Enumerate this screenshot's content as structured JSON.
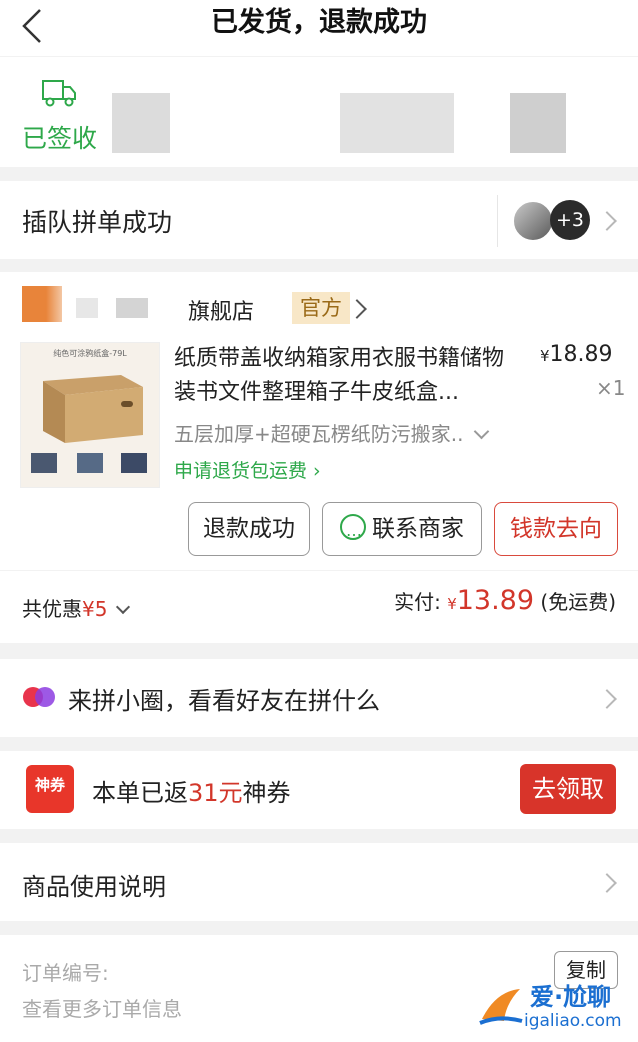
{
  "header": {
    "title": "已发货，退款成功",
    "back_icon": "chevron-left-icon"
  },
  "status": {
    "label": "已签收",
    "icon": "truck-icon"
  },
  "group": {
    "text": "插队拼单成功",
    "extra_count": "+3"
  },
  "order": {
    "shop_name": "旗舰店",
    "official_badge": "官方",
    "product_title": "纸质带盖收纳箱家用衣服书籍储物装书文件整理箱子牛皮纸盒...",
    "price_symbol": "¥",
    "price": "18.89",
    "quantity": "×1",
    "spec": "五层加厚+超硬瓦楞纸防污搬家..",
    "return_link": "申请退货包运费",
    "buttons": {
      "refund": "退款成功",
      "contact": "联系商家",
      "money": "钱款去向"
    },
    "image_label": "纯色可涂鸦纸盒-79L"
  },
  "summary": {
    "discount_label": "共优惠",
    "discount_value": "¥5",
    "paid_label": "实付:",
    "paid_symbol": "¥",
    "paid_amount": "13.89",
    "shipping": "(免运费)"
  },
  "circle": {
    "text": "来拼小圈，看看好友在拼什么"
  },
  "coupon": {
    "badge": "神券",
    "text_prefix": "本单已返",
    "amount": "31元",
    "text_suffix": "神券",
    "button": "去领取"
  },
  "instructions": {
    "text": "商品使用说明"
  },
  "info": {
    "order_no_label": "订单编号:",
    "more_info": "查看更多订单信息",
    "copy_button": "复制"
  },
  "watermark": {
    "title": "爱·尬聊",
    "url": "igaliao.com"
  },
  "colors": {
    "green": "#2ea84a",
    "red": "#d2362a",
    "badge_bg": "#f8e7c7"
  }
}
